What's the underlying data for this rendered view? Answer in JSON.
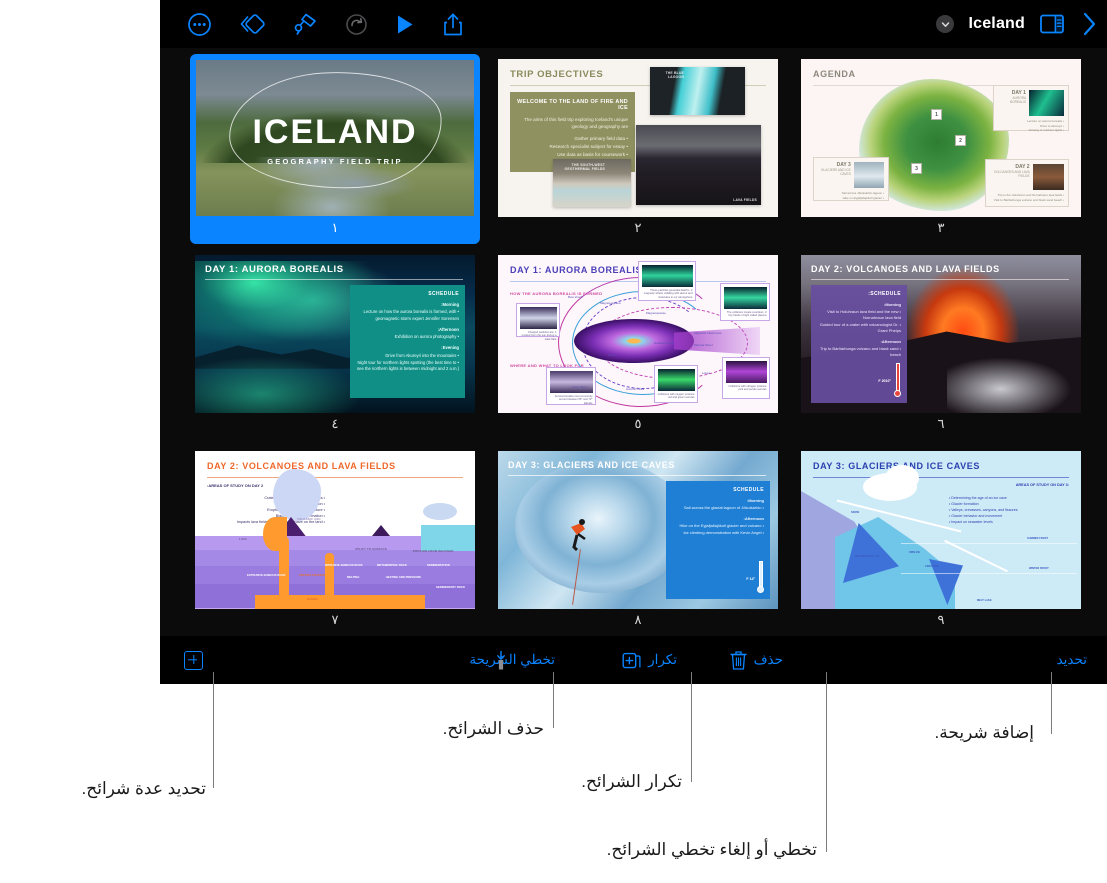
{
  "app": {
    "document_name": "Iceland"
  },
  "toolbar": {
    "items": [
      {
        "name": "more-icon",
        "label": "المزيد"
      },
      {
        "name": "slide-layout-icon",
        "label": "التخطيط"
      },
      {
        "name": "format-brush-icon",
        "label": "تنسيق"
      },
      {
        "name": "undo-icon",
        "label": "تراجع"
      },
      {
        "name": "play-icon",
        "label": "تشغيل"
      },
      {
        "name": "share-icon",
        "label": "مشاركة"
      }
    ],
    "view_options_label": "خيارات العرض",
    "next_label": "التالي"
  },
  "bottom_bar": {
    "select_label": "تحديد",
    "delete_label": "حذف",
    "duplicate_label": "تكرار",
    "skip_slide_label": "تخطي الشريحة",
    "add_slide_label": "إضافة"
  },
  "callouts": [
    {
      "id": "add-slide",
      "text": "إضافة شريحة."
    },
    {
      "id": "skip-slide",
      "text": "تخطي أو إلغاء تخطي الشرائح."
    },
    {
      "id": "duplicate-slides",
      "text": "تكرار الشرائح."
    },
    {
      "id": "delete-slides",
      "text": "حذف الشرائح."
    },
    {
      "id": "select-multiple",
      "text": "تحديد عدة شرائح."
    }
  ],
  "slides": [
    {
      "number": "١",
      "selected": true,
      "title": "ICELAND",
      "subtitle": "GEOGRAPHY FIELD TRIP"
    },
    {
      "number": "٢",
      "selected": false,
      "title": "TRIP OBJECTIVES",
      "box_heading": "WELCOME TO THE LAND OF FIRE AND ICE",
      "box_paragraph": "The aims of this field trip exploring Iceland's unique geology and geography are:",
      "bullets": [
        "• Gather primary field data",
        "• Research specialist subject for essay",
        "• Use data as basis for coursework"
      ],
      "photo_captions": [
        "THE BLUE LAGOON",
        "LAVA FIELDS",
        "THE SOUTH-WEST GEOTHERMAL FIELDS"
      ]
    },
    {
      "number": "٣",
      "selected": false,
      "title": "AGENDA",
      "pins": [
        "1",
        "2",
        "3"
      ],
      "cards": [
        {
          "day": "DAY 1",
          "subject": "AURORA BOREALIS",
          "lines": [
            "• Lecture on aurora borealis",
            "• Drive to Akureyri",
            "• Viewing of northern lights"
          ]
        },
        {
          "day": "DAY 2",
          "subject": "VOLCANOES AND LAVA FIELDS",
          "lines": [
            "• Trip to the Holuhraun and Nornahraun lava fields",
            "• Visit to Bárðarbunga volcano and black sand beach"
          ]
        },
        {
          "day": "DAY 3",
          "subject": "GLACIERS AND ICE CAVES",
          "lines": [
            "• Sail across Jökulsárlón lagoon",
            "• Hike on Eyjafjallajökull glacier"
          ]
        }
      ]
    },
    {
      "number": "٤",
      "selected": false,
      "title": "DAY 1: AURORA BOREALIS",
      "panel_heading": "SCHEDULE",
      "panel_sections": [
        {
          "label": "Morning:",
          "lines": [
            "• Lecture on how the aurora borealis is formed, with geomagnetic storm expert Jennifer Sorensen"
          ]
        },
        {
          "label": "Afternoon:",
          "lines": [
            "• Exhibition on aurora photography"
          ]
        },
        {
          "label": "Evening:",
          "lines": [
            "• Drive from Akureyri into the mountains",
            "• Night tour for northern lights spotting (the best time to see the northern lights is between midnight and 2 a.m.)"
          ]
        }
      ]
    },
    {
      "number": "٥",
      "selected": false,
      "title": "DAY 1: AURORA BOREALIS",
      "sub_headings": [
        "HOW THE AURORA BOREALIS IS FORMED",
        "WHERE AND WHAT TO LOOK FOR"
      ],
      "diagram_labels": [
        "Bow shock",
        "Magnetosphere",
        "Magnetopause",
        "Magnetic Field Lines",
        "Plasma Sheet",
        "Radiation Belts",
        "Solar Wind",
        "Auroral Ovals",
        "Lobes",
        "Poles"
      ],
      "callout_boxes": [
        "1. Charged particles are emitted from the sun during a solar flare",
        "2. These particles penetrate Earth's magnetic shield, colliding with atoms and molecules in our atmosphere",
        "3. The collisions create countless tiny bands of light called plasma",
        "Aurora borealis most commonly occurs between 65° and 72° latitude",
        "Collisions with oxygen produce red and green auroras",
        "Collisions with nitrogen produce pink and purple auroras"
      ]
    },
    {
      "number": "٦",
      "selected": false,
      "title": "DAY 2: VOLCANOES AND LAVA FIELDS",
      "panel_heading": "SCHEDULE:",
      "panel_sections": [
        {
          "label": "Morning:",
          "lines": [
            "• Visit to Holuhraun lava field and the new Nornahraun lava field",
            "• Guided tour of a crater with volcanologist Dr. Grant Phelps"
          ]
        },
        {
          "label": "Afternoon:",
          "lines": [
            "• Trip to Bárðarbunga volcano and black sand beach"
          ]
        }
      ],
      "temperature": "2010° F"
    },
    {
      "number": "٧",
      "selected": false,
      "title": "DAY 2: VOLCANOES AND LAVA FIELDS",
      "sub_heading": "AREAS OF STUDY ON DAY 2:",
      "bullets": [
        "• Craters, lava tubes, and lava fields",
        "• Volcano formation",
        "• Eruptions, fissures, and structure",
        "• Black sand beach formation",
        "• Impacts lava fields and volcanoes have on the land"
      ],
      "diagram_labels": [
        "VOLCANIC ASH",
        "LAVA",
        "UPLIFT TO SURFACE",
        "EROSION FROM WEATHER",
        "EXTRUSIVE IGNEOUS ROCK",
        "INTRUSIVE IGNEOUS ROCK",
        "METAMORPHIC ROCK",
        "SEDIMENTATION",
        "CRYSTALLIZATION",
        "MELTING",
        "HEATING AND PRESSURE",
        "SEDIMENTARY ROCK",
        "MAGMA"
      ]
    },
    {
      "number": "٨",
      "selected": false,
      "title": "DAY 3: GLACIERS AND ICE CAVES",
      "panel_heading": "SCHEDULE",
      "panel_sections": [
        {
          "label": "Morning:",
          "lines": [
            "• Sail across the glacial lagoon of Jökulsárlón"
          ]
        },
        {
          "label": "Afternoon:",
          "lines": [
            "• Hike on the Eyjafjallajökull glacier and volcano",
            "• Ice climbing demonstration with Kevin Angel"
          ]
        }
      ],
      "temperature": "14° F"
    },
    {
      "number": "٩",
      "selected": false,
      "title": "DAY 3: GLACIERS AND ICE CAVES",
      "sub_heading": "AREAS OF STUDY ON DAY 3:",
      "bullets": [
        "• Determining the age of an ice cave",
        "• Glacier formation",
        "• Valleys, crevasses, canyons, and fissures",
        "• Glacier behavior and movement",
        "• Impact on seawater levels"
      ],
      "diagram_labels": [
        "SNOW",
        "METAMORPHIC ICE",
        "FIRN ICE",
        "CREVASSE",
        "SUMMER FROST",
        "WINTER FROST",
        "MELT LAKE"
      ]
    }
  ],
  "colors": {
    "accent": "#0a84ff",
    "app_background": "#0b0b0b",
    "toolbar_background": "#000000",
    "page_background": "#ffffff"
  }
}
